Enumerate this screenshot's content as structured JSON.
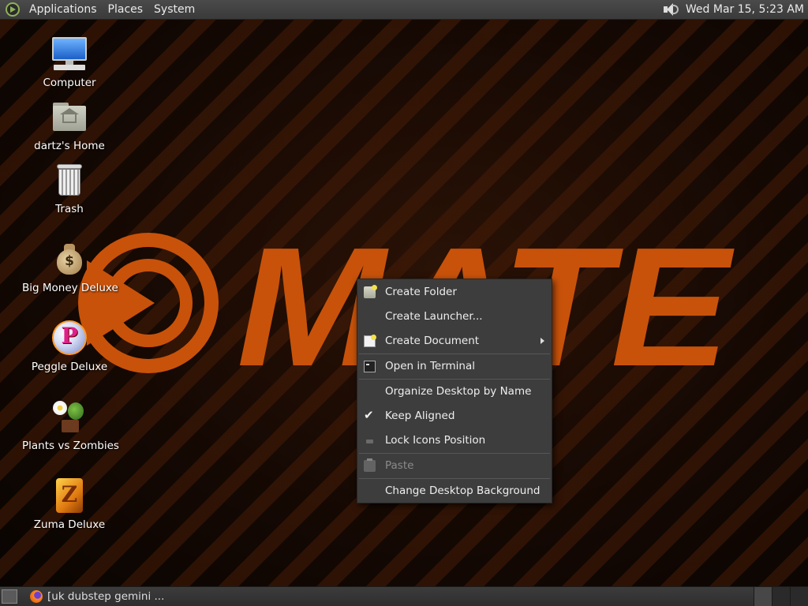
{
  "top_panel": {
    "menus": [
      "Applications",
      "Places",
      "System"
    ],
    "clock": "Wed Mar 15,  5:23 AM"
  },
  "desktop_icons": [
    {
      "label": "Computer",
      "icon": "computer-icon"
    },
    {
      "label": "dartz's Home",
      "icon": "home-folder-icon"
    },
    {
      "label": "Trash",
      "icon": "trash-icon"
    },
    {
      "label": "Big Money Deluxe",
      "icon": "money-bag-icon"
    },
    {
      "label": "Peggle Deluxe",
      "icon": "peggle-icon"
    },
    {
      "label": "Plants vs Zombies",
      "icon": "plants-icon"
    },
    {
      "label": "Zuma Deluxe",
      "icon": "zuma-icon"
    }
  ],
  "wallpaper": {
    "logo_text": "MATE",
    "accent_color": "#c8520a"
  },
  "context_menu": {
    "items": [
      {
        "label": "Create Folder",
        "icon": "folder-new-icon"
      },
      {
        "label": "Create Launcher...",
        "icon": ""
      },
      {
        "label": "Create Document",
        "icon": "document-new-icon",
        "submenu": true
      },
      {
        "label": "Open in Terminal",
        "icon": "terminal-icon"
      },
      {
        "label": "Organize Desktop by Name",
        "icon": ""
      },
      {
        "label": "Keep Aligned",
        "icon": "check-icon",
        "checked": true
      },
      {
        "label": "Lock Icons Position",
        "icon": "lock-icon"
      },
      {
        "label": "Paste",
        "icon": "paste-icon",
        "disabled": true
      },
      {
        "label": "Change Desktop Background",
        "icon": ""
      }
    ]
  },
  "bottom_panel": {
    "task_label": "[uk dubstep gemini ...",
    "workspace_count": 3
  }
}
